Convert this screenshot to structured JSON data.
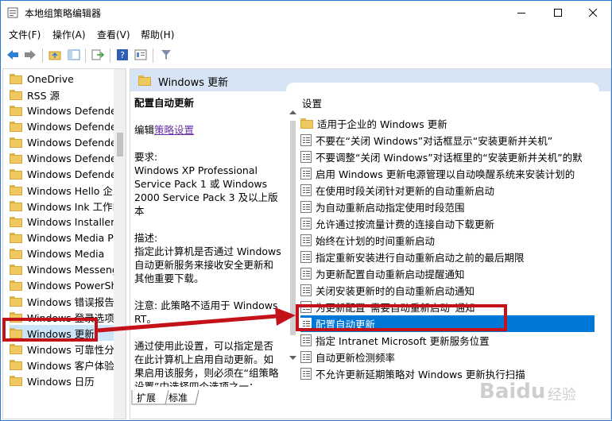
{
  "window": {
    "title": "本地组策略编辑器"
  },
  "menu": [
    "文件(F)",
    "操作(A)",
    "查看(V)",
    "帮助(H)"
  ],
  "tree": {
    "items": [
      {
        "label": "OneDrive"
      },
      {
        "label": "RSS 源"
      },
      {
        "label": "Windows Defender"
      },
      {
        "label": "Windows Defender"
      },
      {
        "label": "Windows Defender"
      },
      {
        "label": "Windows Defender"
      },
      {
        "label": "Windows Defender"
      },
      {
        "label": "Windows Hello 企业"
      },
      {
        "label": "Windows Ink 工作区"
      },
      {
        "label": "Windows Installer"
      },
      {
        "label": "Windows Media P"
      },
      {
        "label": "Windows Media"
      },
      {
        "label": "Windows Messeng"
      },
      {
        "label": "Windows PowerSh"
      },
      {
        "label": "Windows 错误报告"
      },
      {
        "label": "Windows 登录选项"
      },
      {
        "label": "Windows 更新"
      },
      {
        "label": "Windows 可靠性分"
      },
      {
        "label": "Windows 客户体验"
      },
      {
        "label": "Windows 日历"
      }
    ],
    "selected_index": 16
  },
  "panel": {
    "title": "Windows 更新",
    "desc_title": "配置自动更新",
    "edit_prefix": "编辑",
    "edit_link": "策略设置",
    "requirements_label": "要求:",
    "requirements_text": "Windows XP Professional Service Pack 1 或 Windows 2000 Service Pack 3 及以上版本",
    "description_label": "描述:",
    "description_text": "指定此计算机是否通过 Windows 自动更新服务来接收安全更新和其他重要下载。",
    "note_text": "注意: 此策略不适用于 Windows RT。",
    "more_text": "通过使用此设置，可以指定是否在此计算机上启用自动更新。如果启用该服务，则必须在“组策略设置”中选择四个选项之一：",
    "list_header": "设置",
    "rows": [
      {
        "label": "适用于企业的 Windows 更新",
        "folder": true
      },
      {
        "label": "不要在“关闭 Windows”对话框显示“安装更新并关机”"
      },
      {
        "label": "不要调整“关闭 Windows”对话框里的“安装更新并关机”的默"
      },
      {
        "label": "启用 Windows 更新电源管理以自动唤醒系统来安装计划的"
      },
      {
        "label": "在使用时段关闭针对更新的自动重新启动"
      },
      {
        "label": "为自动重新启动指定使用时段范围"
      },
      {
        "label": "允许通过按流量计费的连接自动下载更新"
      },
      {
        "label": "始终在计划的时间重新启动"
      },
      {
        "label": "指定重新安装进行自动重新启动之前的最后期限"
      },
      {
        "label": "为更新配置自动重新启动提醒通知"
      },
      {
        "label": "关闭安装更新时的自动重新启动通知"
      },
      {
        "label": "为更新配置“需要自动重新启动”通知"
      },
      {
        "label": "配置自动更新"
      },
      {
        "label": "指定 Intranet Microsoft 更新服务位置"
      },
      {
        "label": "自动更新检测频率"
      },
      {
        "label": "不允许更新延期策略对 Windows 更新执行扫描"
      }
    ],
    "selected_row": 12,
    "tabs": [
      "扩展",
      "标准"
    ]
  },
  "colors": {
    "accent": "#0078d7",
    "highlight_box": "#c4121a",
    "header_band": "#d6e4f5",
    "link": "#6a2ea5"
  }
}
